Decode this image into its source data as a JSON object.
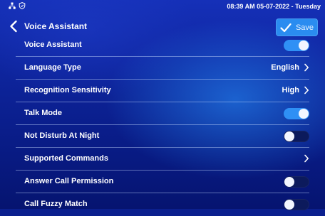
{
  "statusbar": {
    "datetime": "08:39 AM 05-07-2022 - Tuesday",
    "icons": [
      "network-icon",
      "shield-icon"
    ]
  },
  "header": {
    "title": "Voice Assistant",
    "save_label": "Save"
  },
  "colors": {
    "accent": "#2f90f5",
    "background": "#0d2399"
  },
  "settings": [
    {
      "label": "Voice Assistant",
      "type": "toggle",
      "state": "on"
    },
    {
      "label": "Language Type",
      "type": "select",
      "value": "English"
    },
    {
      "label": "Recognition Sensitivity",
      "type": "select",
      "value": "High"
    },
    {
      "label": "Talk Mode",
      "type": "toggle",
      "state": "on"
    },
    {
      "label": "Not Disturb At Night",
      "type": "toggle",
      "state": "off"
    },
    {
      "label": "Supported Commands",
      "type": "link"
    },
    {
      "label": "Answer Call Permission",
      "type": "toggle",
      "state": "off"
    },
    {
      "label": "Call Fuzzy Match",
      "type": "toggle",
      "state": "off"
    }
  ]
}
